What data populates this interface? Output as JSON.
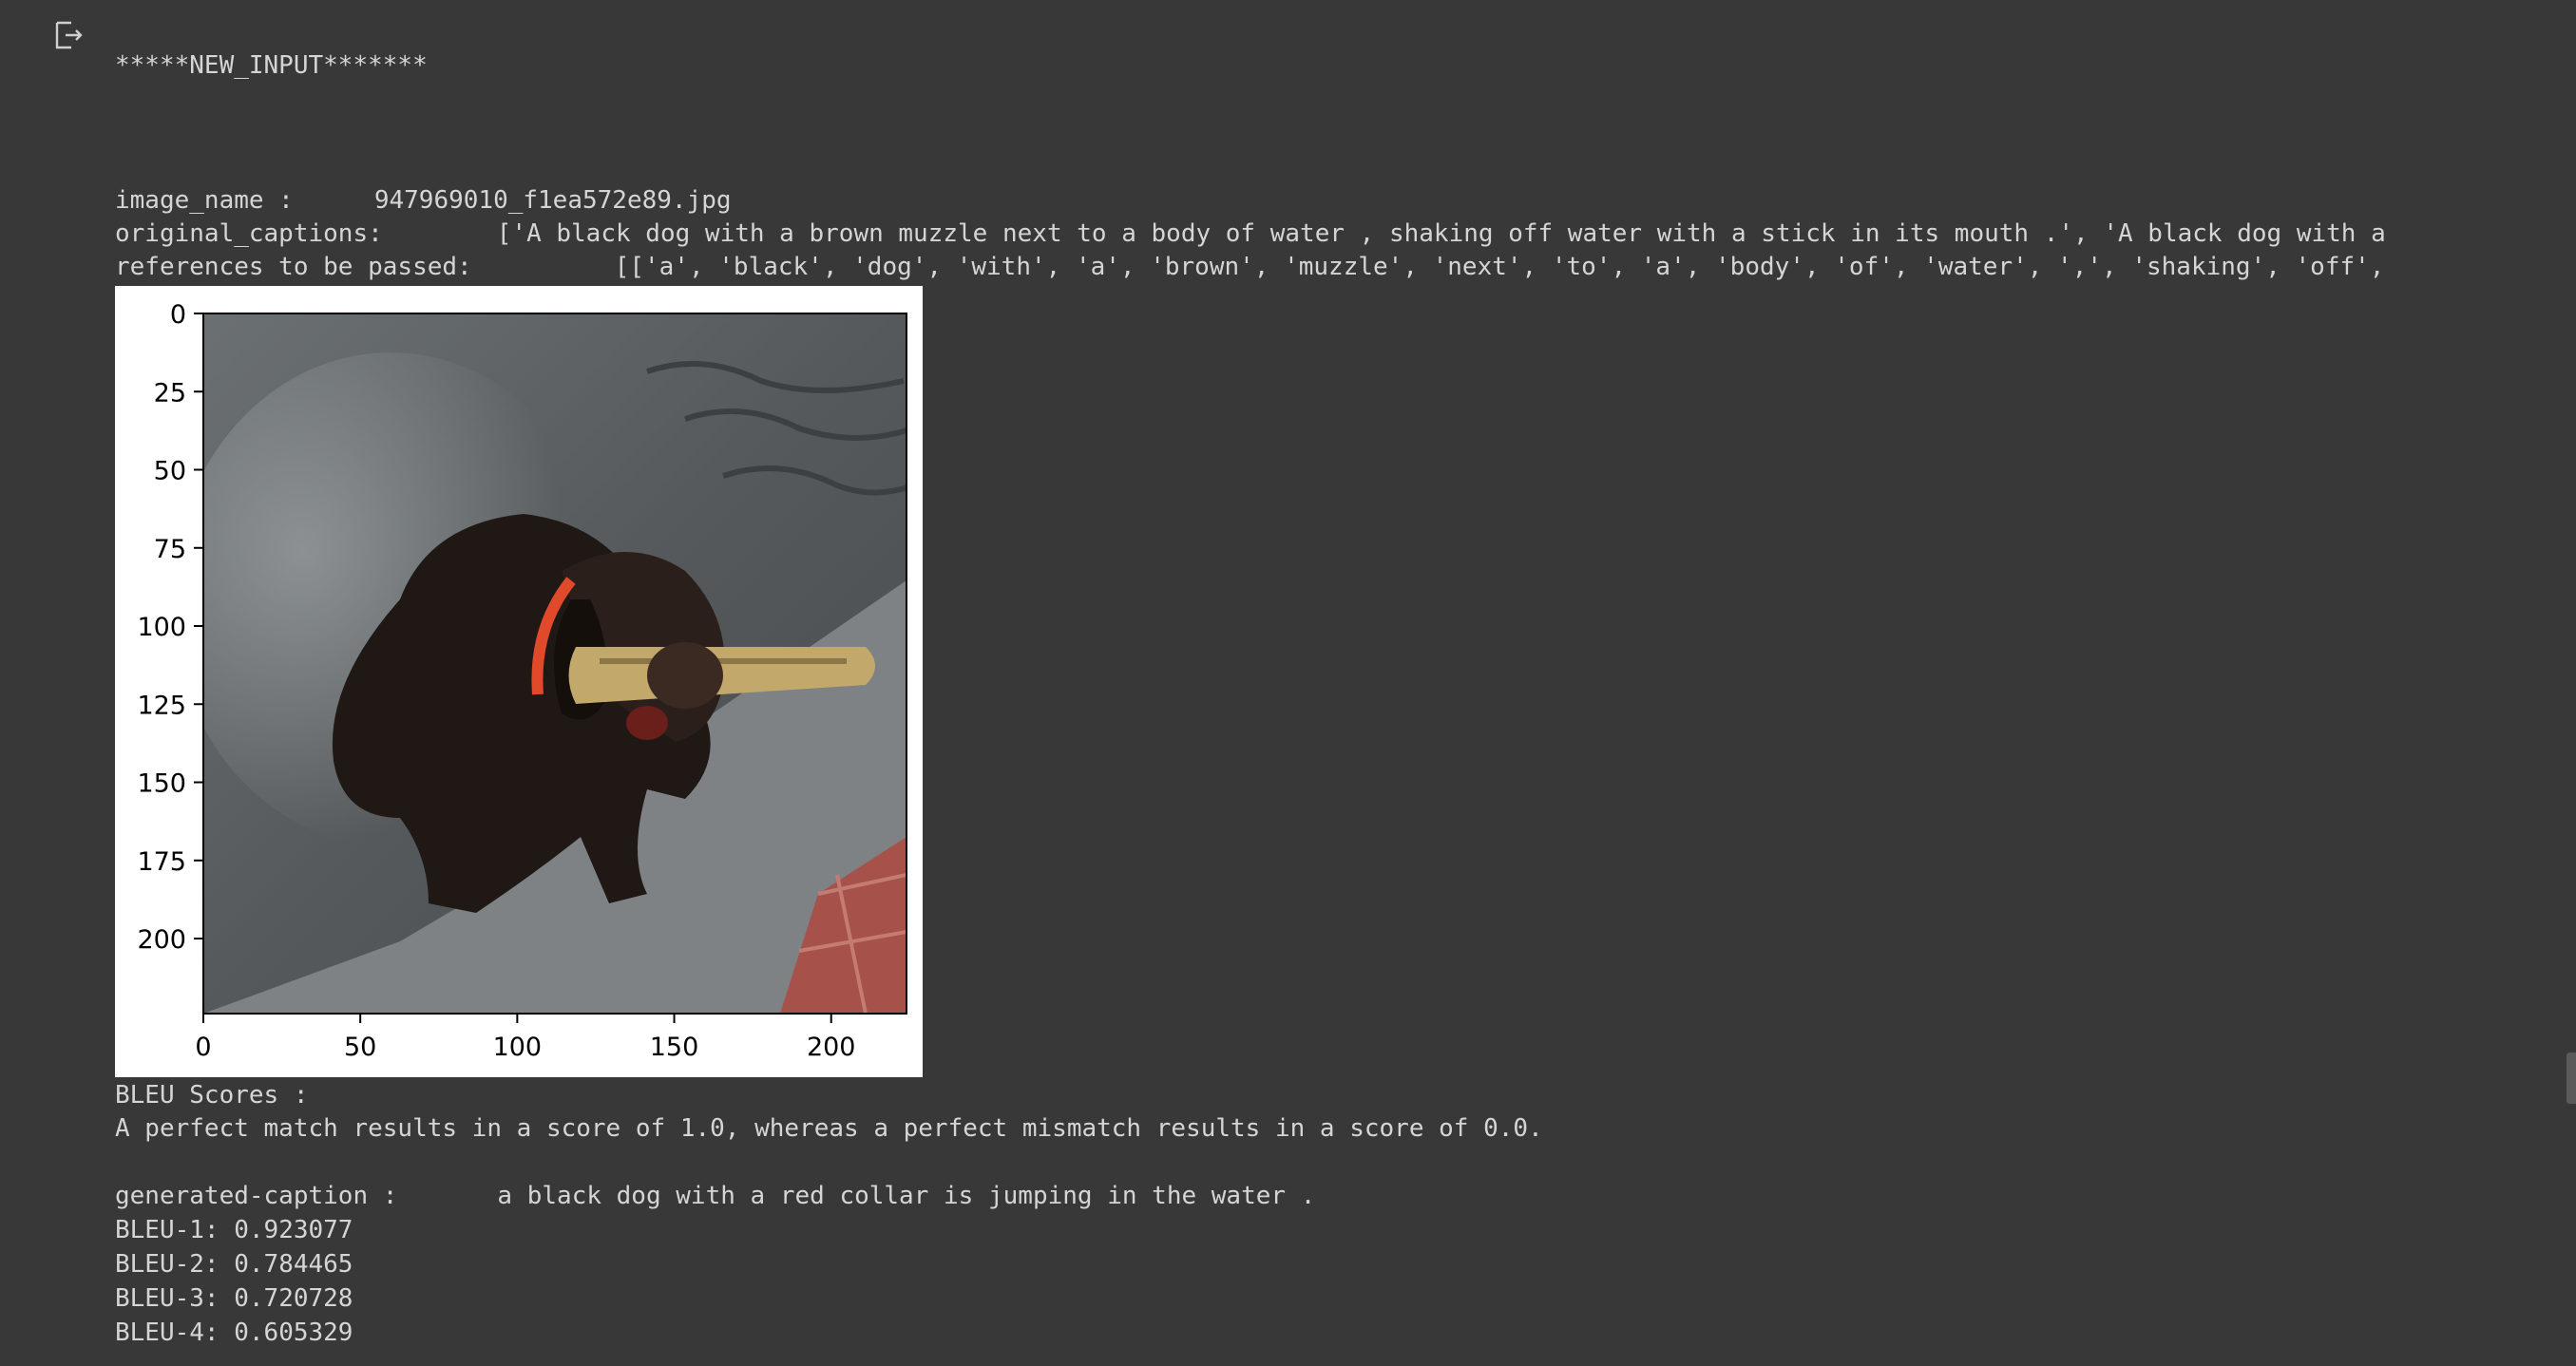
{
  "output": {
    "header": "*****NEW_INPUT*******",
    "image_name_label": "image_name :",
    "image_name_value": "947969010_f1ea572e89.jpg",
    "original_captions_label": "original_captions:",
    "original_captions_value": "['A black dog with a brown muzzle next to a body of water , shaking off water with a stick in its mouth .', 'A black dog with a",
    "references_label": "references to be passed:",
    "references_value": "[['a', 'black', 'dog', 'with', 'a', 'brown', 'muzzle', 'next', 'to', 'a', 'body', 'of', 'water', ',', 'shaking', 'off',",
    "bleu_heading": "BLEU Scores :",
    "bleu_note": "A perfect match results in a score of 1.0, whereas a perfect mismatch results in a score of 0.0.",
    "generated_label": "generated-caption :",
    "generated_value": "a black dog with a red collar is jumping in the water .",
    "bleu": [
      {
        "label": "BLEU-1:",
        "value": "0.923077"
      },
      {
        "label": "BLEU-2:",
        "value": "0.784465"
      },
      {
        "label": "BLEU-3:",
        "value": "0.720728"
      },
      {
        "label": "BLEU-4:",
        "value": "0.605329"
      }
    ]
  },
  "figure": {
    "x_ticks": [
      "0",
      "50",
      "100",
      "150",
      "200"
    ],
    "y_ticks": [
      "0",
      "25",
      "50",
      "75",
      "100",
      "125",
      "150",
      "175",
      "200"
    ],
    "x_tick_values": [
      0,
      50,
      100,
      150,
      200
    ],
    "y_tick_values": [
      0,
      25,
      50,
      75,
      100,
      125,
      150,
      175,
      200
    ],
    "extent": [
      0,
      224
    ],
    "image_description_icon": "dog-photo-icon"
  },
  "icons": {
    "output": "output-redirect-icon"
  },
  "colors": {
    "background": "#383838",
    "text": "#d5d5d5"
  }
}
